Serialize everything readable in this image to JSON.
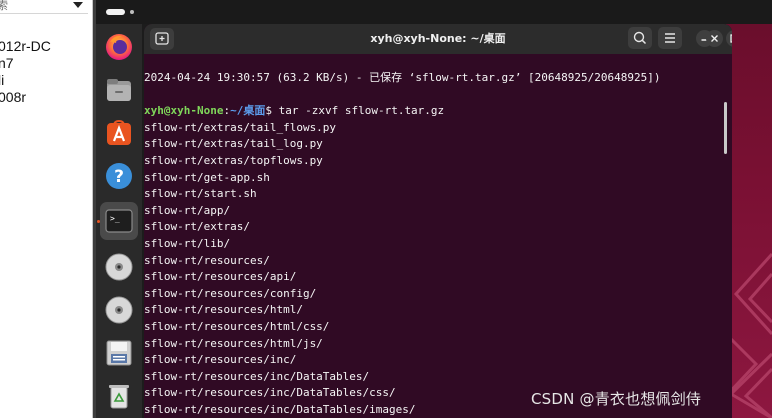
{
  "host": {
    "search_placeholder": "索",
    "items": [
      "012r-DC",
      "n7",
      "li",
      "008r"
    ]
  },
  "terminal": {
    "title": "xyh@xyh-None: ~/桌面",
    "status_line": "2024-04-24 19:30:57 (63.2 KB/s) - 已保存 ‘sflow-rt.tar.gz’ [20648925/20648925])",
    "prompt_user": "xyh@xyh-None",
    "prompt_sep": ":",
    "prompt_path": "~/桌面",
    "prompt_symbol": "$ ",
    "command": "tar -zxvf sflow-rt.tar.gz",
    "output_lines": [
      "sflow-rt/extras/tail_flows.py",
      "sflow-rt/extras/tail_log.py",
      "sflow-rt/extras/topflows.py",
      "sflow-rt/get-app.sh",
      "sflow-rt/start.sh",
      "sflow-rt/app/",
      "sflow-rt/extras/",
      "sflow-rt/lib/",
      "sflow-rt/resources/",
      "sflow-rt/resources/api/",
      "sflow-rt/resources/config/",
      "sflow-rt/resources/html/",
      "sflow-rt/resources/html/css/",
      "sflow-rt/resources/html/js/",
      "sflow-rt/resources/inc/",
      "sflow-rt/resources/inc/DataTables/",
      "sflow-rt/resources/inc/DataTables/css/",
      "sflow-rt/resources/inc/DataTables/images/"
    ]
  },
  "dock": {
    "items": [
      {
        "icon": "firefox-icon",
        "active": false
      },
      {
        "icon": "files-icon",
        "active": false
      },
      {
        "icon": "app-center-icon",
        "active": false
      },
      {
        "icon": "help-icon",
        "active": false
      },
      {
        "icon": "terminal-icon",
        "active": true
      },
      {
        "icon": "disc-icon",
        "active": false
      },
      {
        "icon": "disc-icon",
        "active": false
      },
      {
        "icon": "floppy-icon",
        "active": false
      },
      {
        "icon": "trash-icon",
        "active": false
      }
    ]
  },
  "watermark": "CSDN @青衣也想佩剑侍",
  "colors": {
    "terminal_bg": "#300a24",
    "prompt_user": "#7fd75a",
    "prompt_path": "#5c9ded",
    "accent": "#e95420"
  }
}
